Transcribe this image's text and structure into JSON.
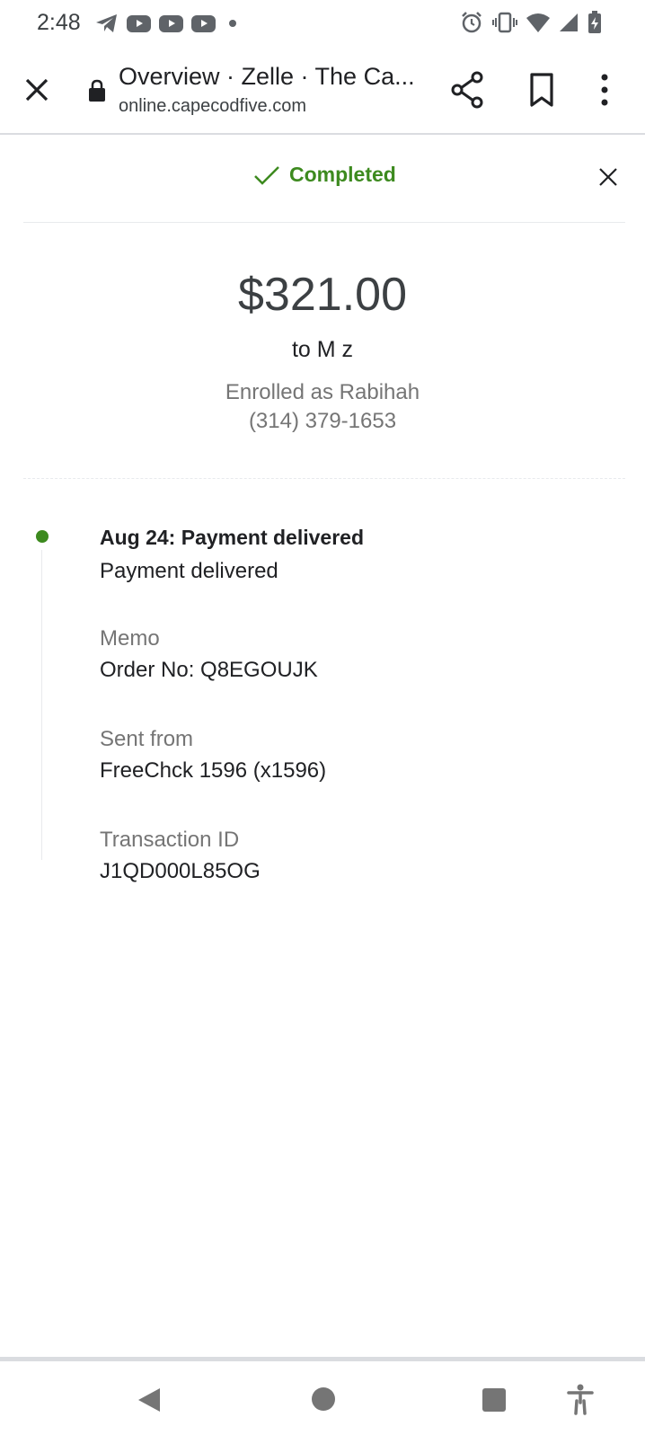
{
  "status_bar": {
    "time": "2:48",
    "left_icons": [
      "telegram-icon",
      "youtube-icon",
      "youtube-icon",
      "youtube-icon",
      "dot-icon"
    ],
    "right_icons": [
      "alarm-icon",
      "vibrate-icon",
      "wifi-icon",
      "signal-icon",
      "battery-charging-icon"
    ]
  },
  "browser": {
    "title": "Overview · Zelle · The Ca...",
    "url": "online.capecodfive.com",
    "icons": [
      "close-icon",
      "lock-icon",
      "share-icon",
      "bookmark-icon",
      "more-vert-icon"
    ]
  },
  "dialog": {
    "status": "Completed",
    "status_color": "#3d8a1f",
    "amount": "$321.00",
    "recipient": "to M z",
    "enrolled_as": "Enrolled as Rabihah",
    "phone": "(314) 379-1653"
  },
  "timeline": {
    "heading": "Aug 24: Payment delivered",
    "description": "Payment delivered",
    "dot_color": "#3d8a1f"
  },
  "details": [
    {
      "label": "Memo",
      "value": "Order No: Q8EGOUJK"
    },
    {
      "label": "Sent from",
      "value": "FreeChck 1596 (x1596)"
    },
    {
      "label": "Transaction ID",
      "value": "J1QD000L85OG"
    }
  ],
  "nav": {
    "icons": [
      "back-icon",
      "home-icon",
      "recents-icon",
      "accessibility-icon"
    ]
  }
}
